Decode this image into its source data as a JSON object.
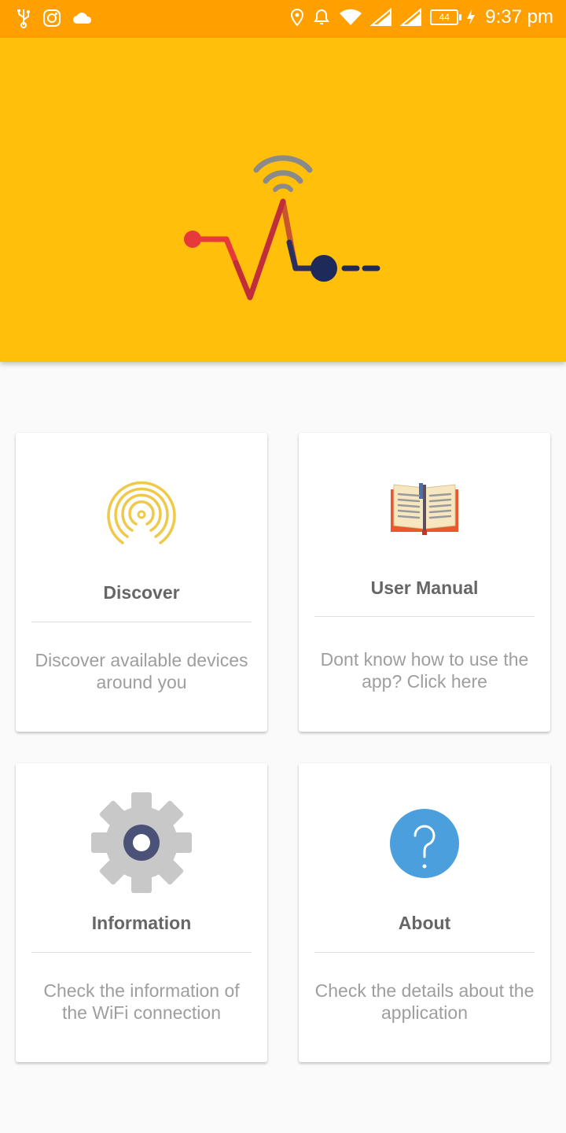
{
  "status_bar": {
    "time": "9:37 pm",
    "battery": "44",
    "left_icons": [
      "usb-icon",
      "instagram-icon",
      "cloud-icon"
    ],
    "right_icons": [
      "location-icon",
      "alarm-icon",
      "wifi-icon",
      "signal-icon",
      "signal-icon",
      "battery-icon",
      "charging-icon"
    ]
  },
  "banner": {
    "logo": "wifi-pulse-logo"
  },
  "cards": {
    "discover": {
      "icon": "radar-icon",
      "title": "Discover",
      "desc_line1": "Discover available devices",
      "desc_line2": "around you"
    },
    "manual": {
      "icon": "open-book-icon",
      "title": "User Manual",
      "desc_line1": "Dont know how to use the",
      "desc_line2": "app? Click here"
    },
    "info": {
      "icon": "gear-icon",
      "title": "Information",
      "desc_line1": "Check the information of",
      "desc_line2": "the WiFi connection"
    },
    "about": {
      "icon": "question-circle-icon",
      "title": "About",
      "desc_line1": "Check the details about the",
      "desc_line2": "application"
    }
  },
  "colors": {
    "status_bar": "#ff9f00",
    "banner": "#ffbf0a",
    "title_text": "#666666",
    "desc_text": "#9e9e9e",
    "about_blue": "#4a9fdc"
  }
}
